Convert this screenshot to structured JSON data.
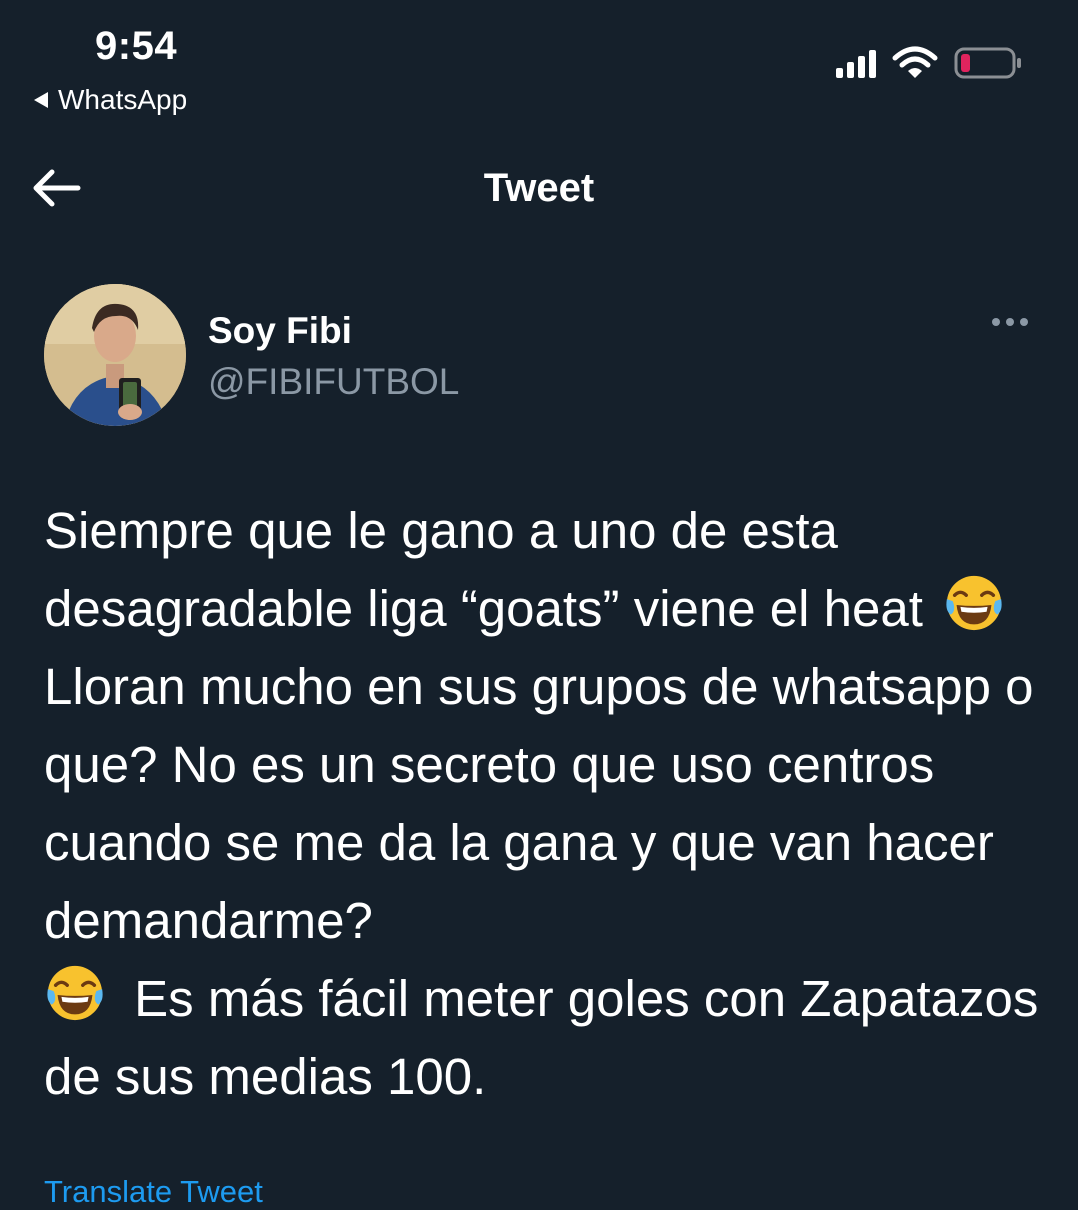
{
  "status_bar": {
    "time": "9:54",
    "back_app": "WhatsApp"
  },
  "header": {
    "title": "Tweet"
  },
  "author": {
    "name": "Soy Fibi",
    "handle": "@FIBIFUTBOL"
  },
  "tweet": {
    "segments": [
      "Siempre que le gano a uno de esta desagradable liga “goats” viene el heat ",
      "Lloran mucho en sus grupos de whatsapp o que? No es un secreto que uso centros cuando se me da la gana y que van hacer demandarme?",
      " Es más fácil meter goles con Zapatazos de sus medias 100."
    ],
    "emoji_name": "face-with-tears-of-joy-icon"
  },
  "actions": {
    "translate": "Translate Tweet"
  },
  "colors": {
    "background": "#15202b",
    "accent": "#1d9bf0",
    "secondary_text": "#8b98a5",
    "battery_low": "#e0245e"
  }
}
